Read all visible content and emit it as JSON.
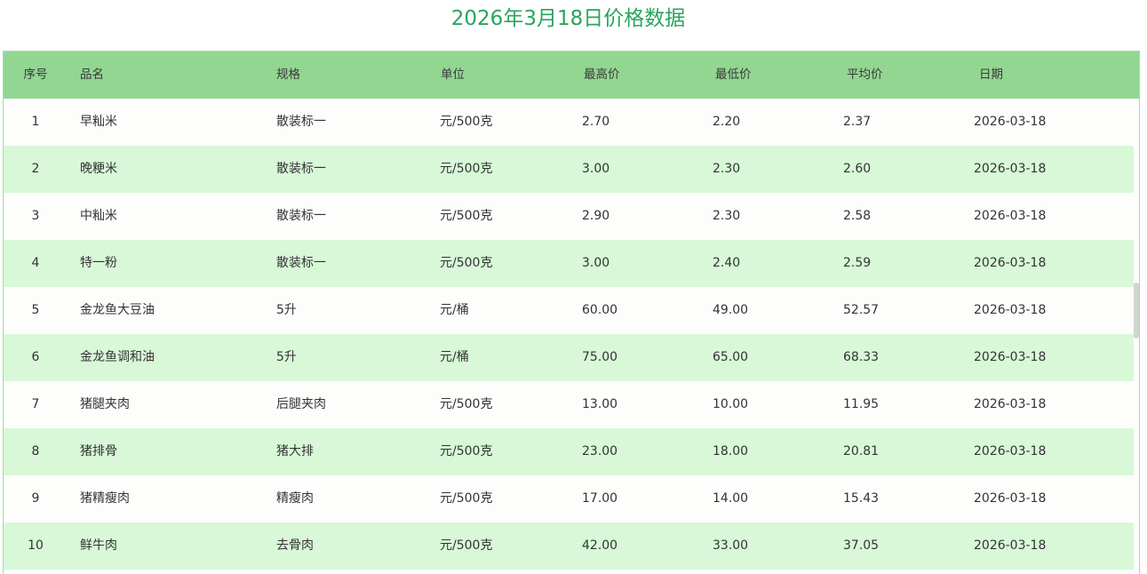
{
  "title": "2026年3月18日价格数据",
  "columns": [
    "序号",
    "品名",
    "规格",
    "单位",
    "最高价",
    "最低价",
    "平均价",
    "日期"
  ],
  "rows": [
    [
      "1",
      "早籼米",
      "散装标一",
      "元/500克",
      "2.70",
      "2.20",
      "2.37",
      "2026-03-18"
    ],
    [
      "2",
      "晚粳米",
      "散装标一",
      "元/500克",
      "3.00",
      "2.30",
      "2.60",
      "2026-03-18"
    ],
    [
      "3",
      "中籼米",
      "散装标一",
      "元/500克",
      "2.90",
      "2.30",
      "2.58",
      "2026-03-18"
    ],
    [
      "4",
      "特一粉",
      "散装标一",
      "元/500克",
      "3.00",
      "2.40",
      "2.59",
      "2026-03-18"
    ],
    [
      "5",
      "金龙鱼大豆油",
      "5升",
      "元/桶",
      "60.00",
      "49.00",
      "52.57",
      "2026-03-18"
    ],
    [
      "6",
      "金龙鱼调和油",
      "5升",
      "元/桶",
      "75.00",
      "65.00",
      "68.33",
      "2026-03-18"
    ],
    [
      "7",
      "猪腿夹肉",
      "后腿夹肉",
      "元/500克",
      "13.00",
      "10.00",
      "11.95",
      "2026-03-18"
    ],
    [
      "8",
      "猪排骨",
      "猪大排",
      "元/500克",
      "23.00",
      "18.00",
      "20.81",
      "2026-03-18"
    ],
    [
      "9",
      "猪精瘦肉",
      "精瘦肉",
      "元/500克",
      "17.00",
      "14.00",
      "15.43",
      "2026-03-18"
    ],
    [
      "10",
      "鲜牛肉",
      "去骨肉",
      "元/500克",
      "42.00",
      "33.00",
      "37.05",
      "2026-03-18"
    ]
  ],
  "colors": {
    "title": "#2aa45d",
    "header_bg": "#92d692",
    "alt_row_bg": "#d8f8d8"
  }
}
